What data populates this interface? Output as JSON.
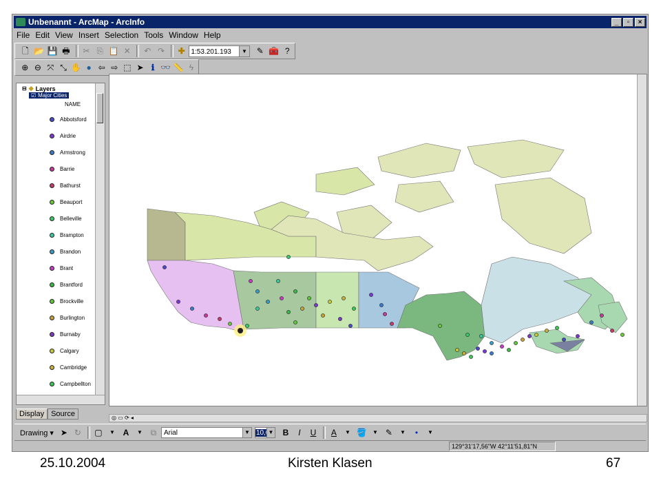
{
  "window": {
    "title": "Unbenannt - ArcMap - ArcInfo"
  },
  "menu": [
    "File",
    "Edit",
    "View",
    "Insert",
    "Selection",
    "Tools",
    "Window",
    "Help"
  ],
  "toolbar": {
    "scale": "1:53.201.193"
  },
  "toc": {
    "root": "Layers",
    "layer": "Major Cities",
    "field": "NAME",
    "cities": [
      {
        "name": "Abbotsford",
        "color": "#4a4ac8"
      },
      {
        "name": "Airdrie",
        "color": "#7a3ad0"
      },
      {
        "name": "Armstrong",
        "color": "#3a7ac8"
      },
      {
        "name": "Barrie",
        "color": "#c83a9a"
      },
      {
        "name": "Bathurst",
        "color": "#c83a6a"
      },
      {
        "name": "Beauport",
        "color": "#6ac83a"
      },
      {
        "name": "Belleville",
        "color": "#3ac86a"
      },
      {
        "name": "Brampton",
        "color": "#3ac8a0"
      },
      {
        "name": "Brandon",
        "color": "#3a9ac8"
      },
      {
        "name": "Brant",
        "color": "#c83ac8"
      },
      {
        "name": "Brantford",
        "color": "#3ab848"
      },
      {
        "name": "Brockville",
        "color": "#5ac83a"
      },
      {
        "name": "Burlington",
        "color": "#c8a03a"
      },
      {
        "name": "Burnaby",
        "color": "#7a3ac8"
      },
      {
        "name": "Calgary",
        "color": "#c8c83a"
      },
      {
        "name": "Cambridge",
        "color": "#c8b03a"
      },
      {
        "name": "Campbellton",
        "color": "#3ac85a"
      }
    ],
    "tabs": [
      "Display",
      "Source"
    ]
  },
  "drawing": {
    "label": "Drawing",
    "font": "Arial",
    "size": "10,0"
  },
  "status": {
    "coords": "129°31'17,56\"W  42°11'51,81\"N"
  },
  "footer": {
    "date": "25.10.2004",
    "author": "Kirsten Klasen",
    "page": "67"
  },
  "map_colors": {
    "bc": "#e6c0f0",
    "alberta": "#a8c8a0",
    "saskatchewan": "#c8e6b0",
    "manitoba": "#a8c8e0",
    "ontario": "#7ab880",
    "quebec": "#c8e0e6",
    "atlantic": "#a8d8b0",
    "yukon": "#b8b890",
    "nwt": "#d8e6a8",
    "nunavut": "#e0e6b8"
  }
}
